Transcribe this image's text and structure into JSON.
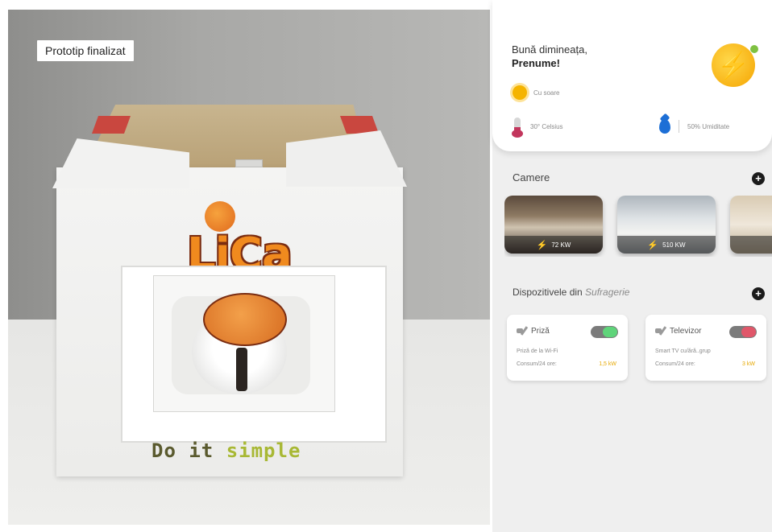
{
  "photo": {
    "overlay_label": "Prototip finalizat",
    "logo_text": "LiCa",
    "slogan_prefix": "Do it ",
    "slogan_highlight": "simple"
  },
  "app": {
    "greeting": "Bună dimineața,",
    "username": "Prenume!",
    "weather": "Cu soare",
    "temperature": "30° Celsius",
    "humidity": "50% Umiditate",
    "rooms_title": "Camere",
    "rooms": [
      {
        "power": "72 KW"
      },
      {
        "power": "510 KW"
      },
      {
        "power": ""
      }
    ],
    "devices_title_prefix": "Dispozitivele din ",
    "devices_room": "Sufragerie",
    "devices": [
      {
        "name": "Priză",
        "description": "Priză de la Wi-Fi",
        "consumption_label": "Consum/24 ore:",
        "consumption_value": "1,5 kW",
        "state": "on"
      },
      {
        "name": "Televizor",
        "description": "Smart TV cu/ără..grup",
        "consumption_label": "Consum/24 ore:",
        "consumption_value": "3 kW",
        "state": "off"
      }
    ],
    "colors": {
      "accent": "#f5b400",
      "toggle_on": "#5fd47a",
      "toggle_off": "#e0576a",
      "drop": "#1d6fd6"
    }
  }
}
